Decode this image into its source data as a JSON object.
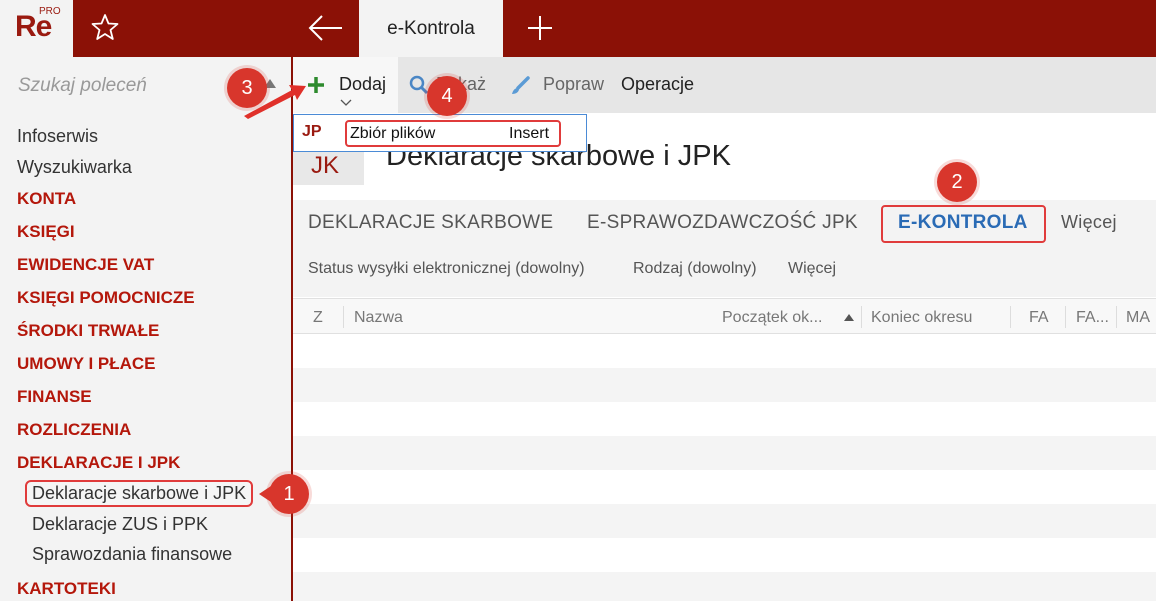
{
  "app": {
    "logo_text": "Re",
    "logo_sup": "PRO",
    "active_tab": "e-Kontrola"
  },
  "sidebar": {
    "search_placeholder": "Szukaj poleceń",
    "items": [
      {
        "label": "Infoserwis",
        "kind": "item"
      },
      {
        "label": "Wyszukiwarka",
        "kind": "item"
      },
      {
        "label": "KONTA",
        "kind": "section"
      },
      {
        "label": "KSIĘGI",
        "kind": "section"
      },
      {
        "label": "EWIDENCJE VAT",
        "kind": "section"
      },
      {
        "label": "KSIĘGI POMOCNICZE",
        "kind": "section"
      },
      {
        "label": "ŚRODKI TRWAŁE",
        "kind": "section"
      },
      {
        "label": "UMOWY I PŁACE",
        "kind": "section"
      },
      {
        "label": "FINANSE",
        "kind": "section"
      },
      {
        "label": "ROZLICZENIA",
        "kind": "section"
      },
      {
        "label": "DEKLARACJE I JPK",
        "kind": "section"
      },
      {
        "label": "Deklaracje skarbowe i JPK",
        "kind": "sub-selected"
      },
      {
        "label": "Deklaracje ZUS i PPK",
        "kind": "sub"
      },
      {
        "label": "Sprawozdania finansowe",
        "kind": "sub"
      },
      {
        "label": "KARTOTEKI",
        "kind": "section"
      }
    ]
  },
  "toolbar": {
    "add": "Dodaj",
    "show": "Pokaż",
    "edit": "Popraw",
    "operations": "Operacje"
  },
  "dropdown": {
    "badge": "JP",
    "label": "Zbiór plików",
    "shortcut": "Insert"
  },
  "page": {
    "icon_text": "JK",
    "title": "Deklaracje skarbowe i JPK"
  },
  "tabs": {
    "t1": "DEKLARACJE SKARBOWE",
    "t2": "E-SPRAWOZDAWCZOŚĆ JPK",
    "t3": "E-KONTROLA",
    "more": "Więcej"
  },
  "filters": {
    "status": "Status wysyłki elektronicznej (dowolny)",
    "type": "Rodzaj (dowolny)",
    "more": "Więcej"
  },
  "grid": {
    "columns": {
      "z": "Z",
      "name": "Nazwa",
      "start": "Początek ok...",
      "end": "Koniec okresu",
      "fa": "FA",
      "fa2": "FA...",
      "ma": "MA"
    }
  },
  "callouts": {
    "c1": "1",
    "c2": "2",
    "c3": "3",
    "c4": "4"
  },
  "colors": {
    "brand": "#8b1106",
    "accent_red": "#b4170b",
    "active_tab_blue": "#2a6bb5",
    "callout": "#d8362c"
  }
}
